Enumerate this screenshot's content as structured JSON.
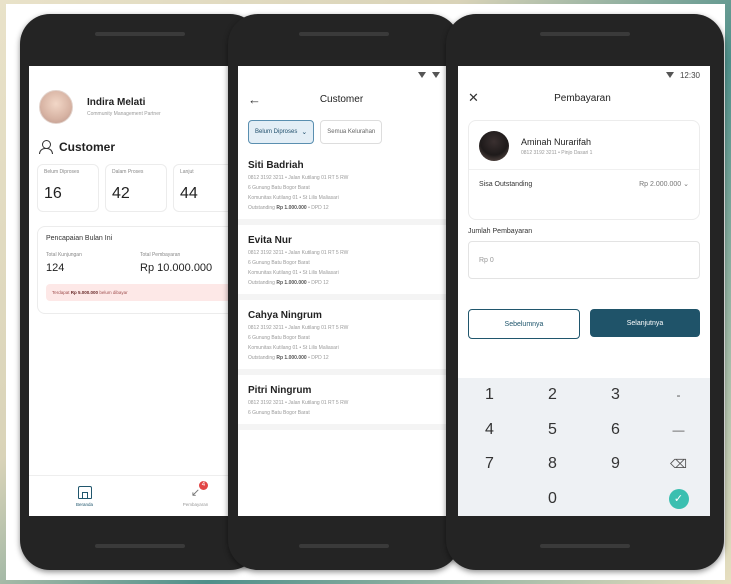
{
  "phone1": {
    "user_name": "Indira Melati",
    "user_role": "Community Management Partner",
    "section_title": "Customer",
    "stats": [
      {
        "label": "Belum Diproses",
        "value": "16"
      },
      {
        "label": "Dalam Proses",
        "value": "42"
      },
      {
        "label": "Lanjut",
        "value": "44"
      }
    ],
    "monthly": {
      "title": "Pencapaian Bulan Ini",
      "visits_label": "Total Kunjungan",
      "visits_value": "124",
      "payments_label": "Total Pembayaran",
      "payments_value": "Rp 10.000.000",
      "alert_prefix": "Terdapat",
      "alert_amount": "Rp 5.000.000",
      "alert_suffix": "belum dibayar"
    },
    "nav": [
      {
        "label": "Beranda"
      },
      {
        "label": "Pembayaran",
        "badge": "4"
      }
    ]
  },
  "phone2": {
    "title": "Customer",
    "filters": [
      {
        "label": "Belum Diproses"
      },
      {
        "label": "Semua Kelurahan"
      }
    ],
    "customers": [
      {
        "name": "Siti Badriah",
        "line1": "0812 3192 3211 • Jalan Kutilang 01 RT 5 RW",
        "line2": "6 Gunung Batu Bogor Barat",
        "line3": "Komunitas Kutilang 01 • St Lilis Maliasari",
        "out_prefix": "Outstanding",
        "out_amount": "Rp 1.000.000",
        "out_suffix": "• DPD 12"
      },
      {
        "name": "Evita Nur",
        "line1": "0812 3192 3211 • Jalan Kutilang 01 RT 5 RW",
        "line2": "6 Gunung Batu Bogor Barat",
        "line3": "Komunitas Kutilang 01 • St Lilis Maliasari",
        "out_prefix": "Outstanding",
        "out_amount": "Rp 1.000.000",
        "out_suffix": "• DPD 12"
      },
      {
        "name": "Cahya Ningrum",
        "line1": "0812 3192 3211 • Jalan Kutilang 01 RT 5 RW",
        "line2": "6 Gunung Batu Bogor Barat",
        "line3": "Komunitas Kutilang 01 • St Lilis Maliasari",
        "out_prefix": "Outstanding",
        "out_amount": "Rp 1.000.000",
        "out_suffix": "• DPD 12"
      },
      {
        "name": "Pitri Ningrum",
        "line1": "0812 3192 3211 • Jalan Kutilang 01 RT 5 RW",
        "line2": "6 Gunung Batu Bogor Barat"
      }
    ]
  },
  "phone3": {
    "status_time": "12:30",
    "title": "Pembayaran",
    "customer_name": "Aminah Nurarifah",
    "customer_sub": "0812 3192 3211 • Pinjo Dasari 1",
    "outstanding_label": "Sisa Outstanding",
    "outstanding_value": "Rp 2.000.000",
    "amount_label": "Jumlah Pembayaran",
    "amount_placeholder": "Rp 0",
    "btn_prev": "Sebelumnya",
    "btn_next": "Selanjutnya",
    "keys": [
      "1",
      "2",
      "3",
      "-",
      "4",
      "5",
      "6",
      "—",
      "7",
      "8",
      "9",
      "⌫",
      "",
      "0",
      "",
      "✓"
    ]
  },
  "colors": {
    "brand": "#1f5369",
    "accent": "#3bbfb0",
    "badge": "#e24545"
  }
}
